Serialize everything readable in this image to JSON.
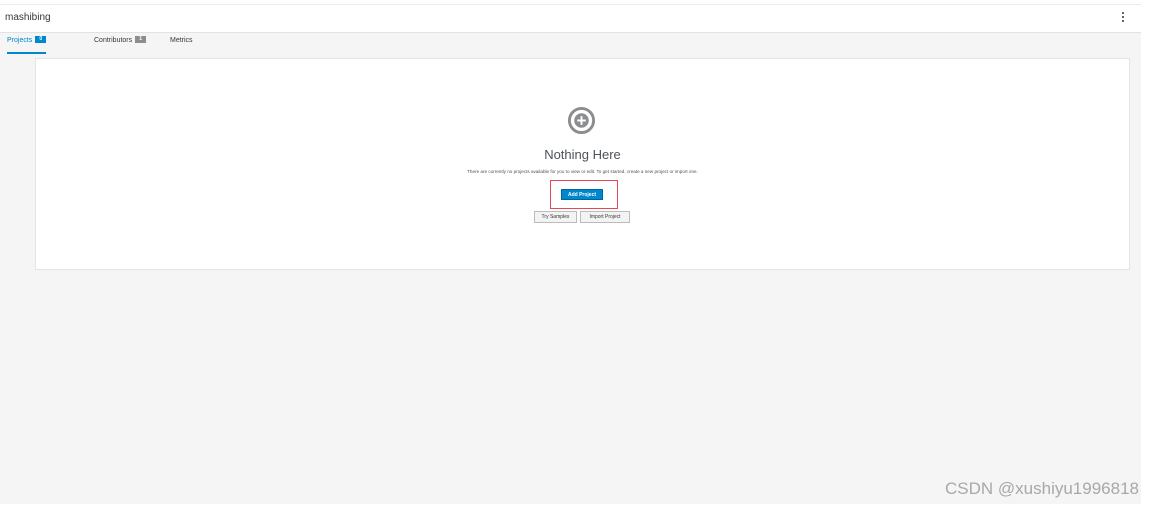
{
  "header": {
    "space_name": "mashibing",
    "menu_icon": "kebab-vertical-icon"
  },
  "tabs": [
    {
      "label": "Projects",
      "badge": "0",
      "active": true
    },
    {
      "label": "Contributors",
      "badge": "1",
      "active": false
    },
    {
      "label": "Metrics",
      "active": false
    }
  ],
  "empty_state": {
    "icon": "plus-circle-icon",
    "title": "Nothing Here",
    "description": "There are currently no projects available for you to view or edit. To get started, create a new project or import one.",
    "primary_button": "Add Project",
    "secondary_buttons": [
      "Try Samples",
      "Import Project"
    ]
  },
  "watermark": "CSDN @xushiyu1996818",
  "colors": {
    "accent": "#0088ce",
    "highlight_border": "#e34a55",
    "background": "#f5f5f5"
  }
}
